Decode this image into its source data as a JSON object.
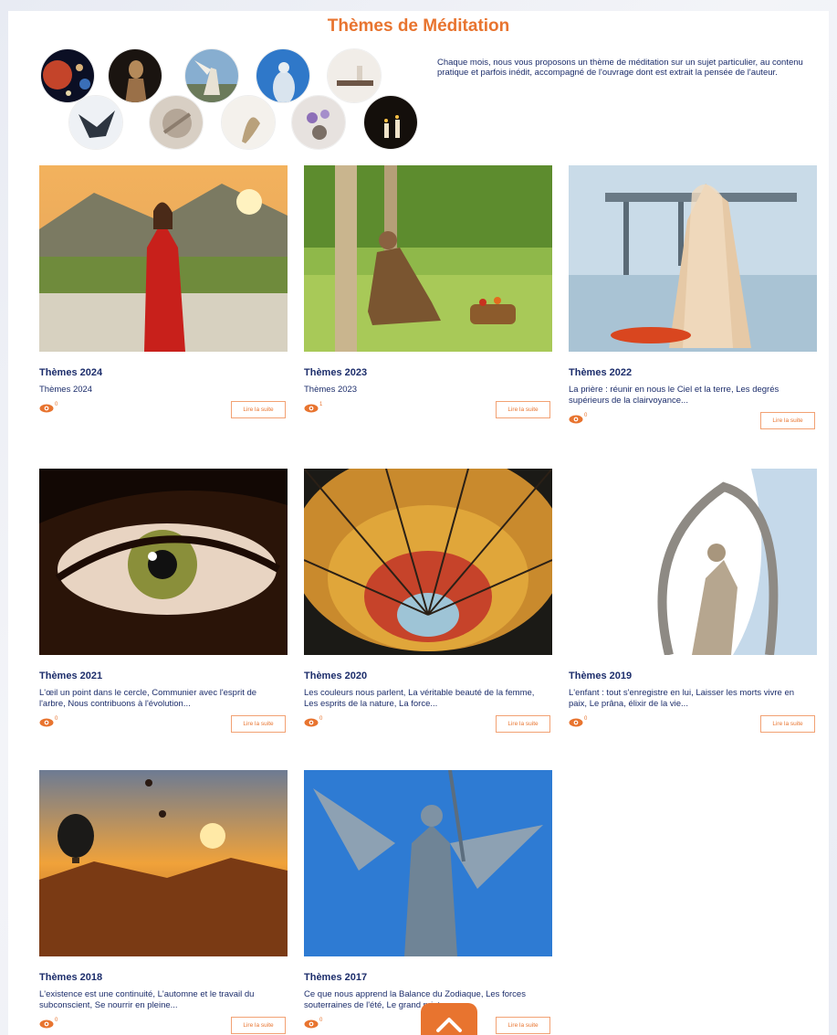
{
  "page": {
    "title": "Thèmes de Méditation",
    "intro": "Chaque mois, nous vous proposons un thème de méditation sur un sujet particulier, au contenu pratique et parfois inédit, accompagné de l'ouvrage dont est extrait la pensée de l'auteur."
  },
  "colors": {
    "accent": "#e8742f",
    "title_blue": "#1c2d6b",
    "button_border": "#f2a173"
  },
  "header_circles": [
    {
      "icon": "planets-image"
    },
    {
      "icon": "statue-image"
    },
    {
      "icon": "angel-statue-image"
    },
    {
      "icon": "blue-figure-image"
    },
    {
      "icon": "table-image"
    },
    {
      "icon": "winged-statue-image"
    },
    {
      "icon": "relief-image"
    },
    {
      "icon": "sculpture-image"
    },
    {
      "icon": "flowers-image"
    },
    {
      "icon": "candles-image"
    }
  ],
  "cards": [
    {
      "title": "Thèmes 2024",
      "desc": "Thèmes 2024",
      "views": "0",
      "button": "Lire la suite"
    },
    {
      "title": "Thèmes 2023",
      "desc": "Thèmes 2023",
      "views": "1",
      "button": "Lire la suite"
    },
    {
      "title": "Thèmes 2022",
      "desc": "La prière : réunir en nous le Ciel et la terre, Les degrés supérieurs de la clairvoyance...",
      "views": "0",
      "button": "Lire la suite"
    },
    {
      "title": "Thèmes 2021",
      "desc": "L'œil un point dans le cercle, Communier avec l'esprit de l'arbre, Nous contribuons à l'évolution...",
      "views": "0",
      "button": "Lire la suite"
    },
    {
      "title": "Thèmes 2020",
      "desc": "Les couleurs nous parlent, La véritable beauté de la femme, Les esprits de la nature, La force...",
      "views": "0",
      "button": "Lire la suite"
    },
    {
      "title": "Thèmes 2019",
      "desc": "L'enfant : tout s'enregistre en lui, Laisser les morts vivre en paix, Le prâna, élixir de la vie...",
      "views": "0",
      "button": "Lire la suite"
    },
    {
      "title": "Thèmes 2018",
      "desc": "L'existence est une continuité, L'automne et le travail du subconscient, Se nourrir en pleine...",
      "views": "0",
      "button": "Lire la suite"
    },
    {
      "title": "Thèmes 2017",
      "desc": "Ce que nous apprend la Balance du Zodiaque, Les forces souterraines de l'été, Le grand printemps...",
      "views": "0",
      "button": "Lire la suite"
    }
  ]
}
